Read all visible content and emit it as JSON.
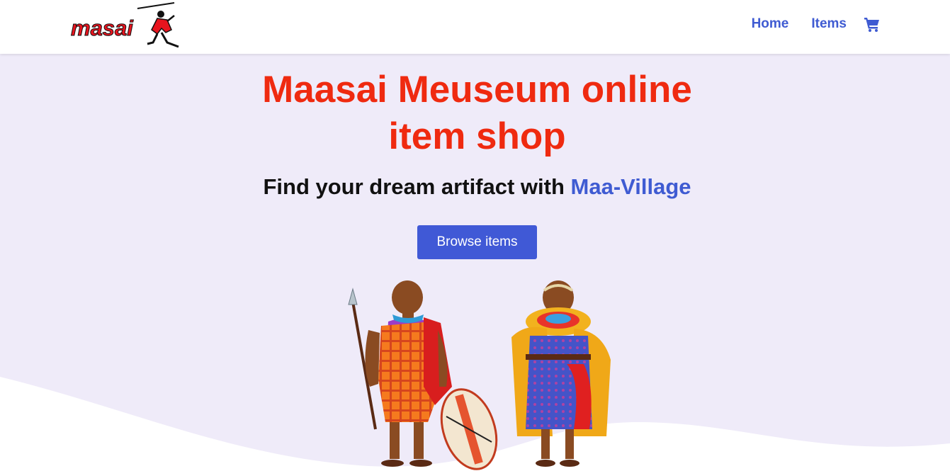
{
  "brand": {
    "logo_text": "masai"
  },
  "nav": {
    "home_label": "Home",
    "items_label": "Items",
    "cart_icon": "shopping-cart-icon"
  },
  "hero": {
    "title": "Maasai Meuseum online item shop",
    "subtitle_prefix": "Find your dream artifact with ",
    "subtitle_brand": "Maa-Village",
    "button_label": "Browse items"
  },
  "colors": {
    "accent_blue": "#3f5bd2",
    "title_red": "#ef2a10",
    "hero_bg": "#efebf9",
    "button_bg": "#4059d6"
  }
}
